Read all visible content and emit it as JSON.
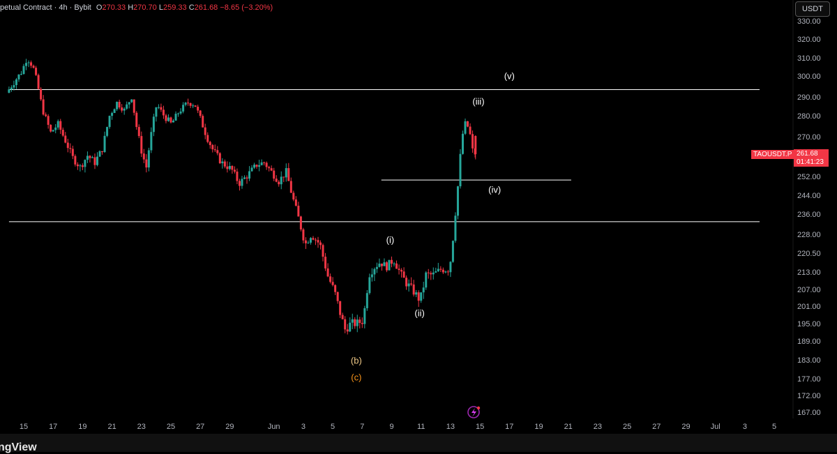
{
  "header": {
    "title": "petual Contract · 4h · Bybit",
    "o_label": "O",
    "o_value": "270.33",
    "h_label": "H",
    "h_value": "270.70",
    "l_label": "L",
    "l_value": "259.33",
    "c_label": "C",
    "c_value": "261.68",
    "change": "−8.65 (−3.20%)",
    "currency_button": "USDT"
  },
  "price_marker": {
    "symbol": "TAOUSDT.P",
    "price": "261.68",
    "countdown": "01:41:23"
  },
  "branding": {
    "logo_text": "ngView"
  },
  "colors": {
    "up": "#26a69a",
    "down": "#f23645",
    "background": "#000000",
    "hline": "#ffffff",
    "orange_label": "#f7931a",
    "yellow_label": "#f0c987"
  },
  "chart_data": {
    "type": "candlestick",
    "interval": "4h",
    "ylim": [
      164,
      333
    ],
    "y_ticks": [
      "330.00",
      "320.00",
      "310.00",
      "300.00",
      "290.00",
      "280.00",
      "270.00",
      "261.00",
      "252.00",
      "244.00",
      "236.00",
      "228.00",
      "220.50",
      "213.00",
      "207.00",
      "201.00",
      "195.00",
      "189.00",
      "183.00",
      "177.00",
      "172.00",
      "167.00"
    ],
    "x_ticks": [
      {
        "label": "15",
        "day": 15
      },
      {
        "label": "17",
        "day": 17
      },
      {
        "label": "19",
        "day": 19
      },
      {
        "label": "21",
        "day": 21
      },
      {
        "label": "23",
        "day": 23
      },
      {
        "label": "25",
        "day": 25
      },
      {
        "label": "27",
        "day": 27
      },
      {
        "label": "29",
        "day": 29
      },
      {
        "label": "Jun",
        "day": 32
      },
      {
        "label": "3",
        "day": 34
      },
      {
        "label": "5",
        "day": 36
      },
      {
        "label": "7",
        "day": 38
      },
      {
        "label": "9",
        "day": 40
      },
      {
        "label": "11",
        "day": 42
      },
      {
        "label": "13",
        "day": 44
      },
      {
        "label": "15",
        "day": 46
      },
      {
        "label": "17",
        "day": 48
      },
      {
        "label": "19",
        "day": 50
      },
      {
        "label": "21",
        "day": 52
      },
      {
        "label": "23",
        "day": 54
      },
      {
        "label": "25",
        "day": 56
      },
      {
        "label": "27",
        "day": 58
      },
      {
        "label": "29",
        "day": 60
      },
      {
        "label": "Jul",
        "day": 62
      },
      {
        "label": "3",
        "day": 64
      },
      {
        "label": "5",
        "day": 66
      }
    ],
    "horizontal_lines": [
      {
        "price": 293.5,
        "from_day": 14,
        "to_day": 65
      },
      {
        "price": 250.5,
        "from_day": 39.3,
        "to_day": 52.2
      },
      {
        "price": 233.0,
        "from_day": 14,
        "to_day": 65
      }
    ],
    "wave_labels": [
      {
        "text": "(v)",
        "day": 48.0,
        "price": 298.5,
        "color": "#ffffff"
      },
      {
        "text": "(iii)",
        "day": 45.9,
        "price": 286.0,
        "color": "#ffffff"
      },
      {
        "text": "(iv)",
        "day": 47.0,
        "price": 245.0,
        "color": "#ffffff"
      },
      {
        "text": "(i)",
        "day": 39.9,
        "price": 224.5,
        "color": "#ffffff"
      },
      {
        "text": "(ii)",
        "day": 41.9,
        "price": 197.5,
        "color": "#ffffff"
      },
      {
        "text": "(b)",
        "day": 37.6,
        "price": 181.8,
        "color": "#f0c987"
      },
      {
        "text": "(c)",
        "day": 37.6,
        "price": 176.5,
        "color": "#f7931a"
      }
    ],
    "anchors": [
      [
        14.0,
        292
      ],
      [
        14.6,
        298
      ],
      [
        15.0,
        302
      ],
      [
        15.4,
        310
      ],
      [
        15.8,
        305
      ],
      [
        16.1,
        296
      ],
      [
        16.5,
        282
      ],
      [
        17.0,
        272
      ],
      [
        17.5,
        276
      ],
      [
        18.0,
        268
      ],
      [
        18.5,
        260
      ],
      [
        19.0,
        256
      ],
      [
        19.5,
        261
      ],
      [
        20.0,
        258
      ],
      [
        20.5,
        264
      ],
      [
        21.0,
        280
      ],
      [
        21.5,
        287
      ],
      [
        22.0,
        283
      ],
      [
        22.5,
        290
      ],
      [
        22.8,
        276
      ],
      [
        23.2,
        262
      ],
      [
        23.5,
        256
      ],
      [
        23.8,
        270
      ],
      [
        24.2,
        286
      ],
      [
        24.7,
        280
      ],
      [
        25.2,
        276
      ],
      [
        25.7,
        282
      ],
      [
        26.3,
        287
      ],
      [
        26.8,
        286
      ],
      [
        27.1,
        280
      ],
      [
        27.6,
        270
      ],
      [
        28.0,
        264
      ],
      [
        28.6,
        258
      ],
      [
        29.3,
        255
      ],
      [
        29.8,
        249
      ],
      [
        30.3,
        252
      ],
      [
        31.0,
        257
      ],
      [
        31.5,
        258
      ],
      [
        32.0,
        254
      ],
      [
        32.5,
        250
      ],
      [
        33.0,
        254
      ],
      [
        33.4,
        244
      ],
      [
        33.9,
        233
      ],
      [
        34.3,
        224
      ],
      [
        34.7,
        228
      ],
      [
        35.3,
        224
      ],
      [
        35.8,
        212
      ],
      [
        36.3,
        206
      ],
      [
        36.7,
        198
      ],
      [
        37.0,
        193
      ],
      [
        37.4,
        195
      ],
      [
        37.8,
        195
      ],
      [
        38.2,
        196
      ],
      [
        38.4,
        202
      ],
      [
        38.6,
        212
      ],
      [
        39.0,
        215
      ],
      [
        39.4,
        217
      ],
      [
        39.8,
        215
      ],
      [
        40.3,
        218
      ],
      [
        40.8,
        212
      ],
      [
        41.2,
        209
      ],
      [
        41.7,
        206
      ],
      [
        42.1,
        203
      ],
      [
        42.5,
        212
      ],
      [
        43.0,
        212
      ],
      [
        43.5,
        214
      ],
      [
        44.1,
        214
      ],
      [
        44.4,
        230
      ],
      [
        44.7,
        250
      ],
      [
        44.95,
        270
      ],
      [
        45.2,
        277
      ],
      [
        45.45,
        273
      ],
      [
        45.7,
        262
      ]
    ],
    "last_candle": {
      "open": 270.33,
      "high": 270.7,
      "low": 259.33,
      "close": 261.68
    }
  }
}
